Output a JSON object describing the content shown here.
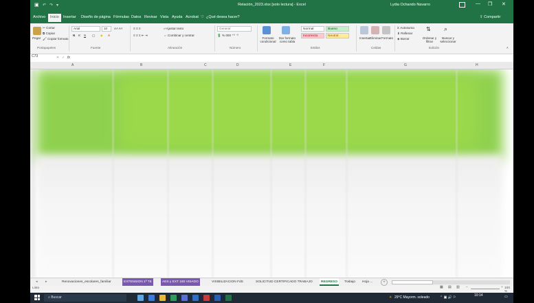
{
  "window": {
    "title": "Relación_2023.xlsx  [solo lectura]  -  Excel",
    "user": "Lydia Ochando Navarro",
    "icons": {
      "save": "save-icon",
      "undo": "undo-icon",
      "redo": "redo-icon",
      "ribbon_options": "ribbon-display-icon",
      "minimize": "minimize-icon",
      "maximize": "maximize-icon",
      "close": "close-icon"
    }
  },
  "menu": {
    "tabs": [
      "Archivo",
      "Inicio",
      "Insertar",
      "Diseño de página",
      "Fórmulas",
      "Datos",
      "Revisar",
      "Vista",
      "Ayuda",
      "Acrobat"
    ],
    "search": "¿Qué desea hacer?",
    "share": "Compartir"
  },
  "ribbon": {
    "clipboard": {
      "paste": "Pegar",
      "cut": "Cortar",
      "copy": "Copiar",
      "format_painter": "Copiar formato",
      "group": "Portapapeles"
    },
    "font": {
      "name": "Arial",
      "size": "10",
      "group": "Fuente"
    },
    "alignment": {
      "wrap": "Ajustar texto",
      "merge": "Combinar y centrar",
      "group": "Alineación"
    },
    "number": {
      "format": "General",
      "group": "Número"
    },
    "styles": {
      "conditional": "Formato condicional",
      "as_table": "Dar formato como tabla",
      "normal": "Normal",
      "bueno": "Bueno",
      "incorrecto": "Incorrecto",
      "neutral": "Neutral",
      "group": "Estilos"
    },
    "cells": {
      "insert": "Insertar",
      "delete": "Eliminar",
      "format": "Formato",
      "group": "Celdas"
    },
    "editing": {
      "autosum": "Autosuma",
      "fill": "Rellenar",
      "clear": "Borrar",
      "sort": "Ordenar y filtrar",
      "find": "Buscar y seleccionar",
      "group": "Edición"
    }
  },
  "formula_bar": {
    "name_box": "C73",
    "fx": "fx",
    "value": ""
  },
  "columns": [
    "A",
    "B",
    "C",
    "D",
    "E",
    "F",
    "G",
    "H"
  ],
  "sheets": {
    "tabs": [
      {
        "label": "Renovaciones_escolares_familiar",
        "style": "plain"
      },
      {
        "label": "EXTENSION 1ª TE",
        "style": "purple"
      },
      {
        "label": "AES y EXT 180 VISADO",
        "style": "purple"
      },
      {
        "label": "VISIBILIZACION FdS",
        "style": "plain"
      },
      {
        "label": "SOLICITUD CERTIFICADO TRABAJO",
        "style": "plain"
      },
      {
        "label": "REGRESO",
        "style": "active"
      },
      {
        "label": "Trabajo",
        "style": "plain"
      },
      {
        "label": "Hoja ...",
        "style": "plain"
      }
    ]
  },
  "status": {
    "ready": "Listo",
    "zoom": "100 %"
  },
  "taskbar": {
    "search_placeholder": "Buscar",
    "weather": "29°C  Mayorm. soleado",
    "time": "10:14",
    "date": ""
  }
}
